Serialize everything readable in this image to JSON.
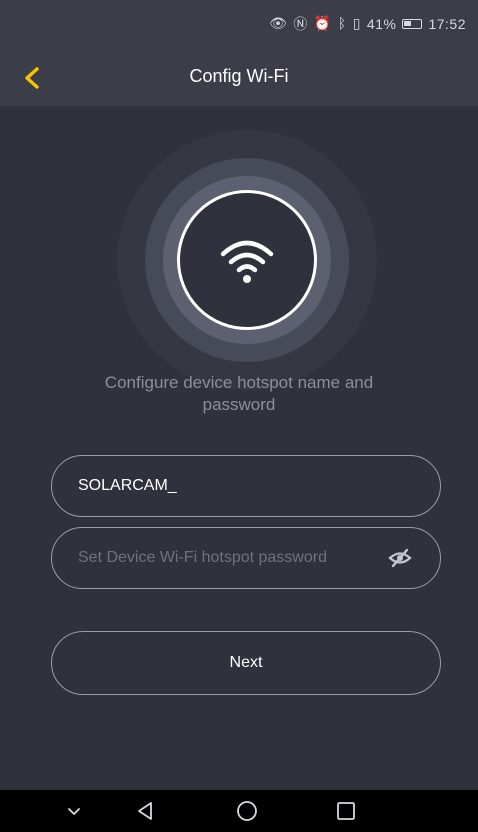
{
  "status_bar": {
    "battery_percent": "41%",
    "time": "17:52",
    "icons": [
      "eye-comfort-icon",
      "nfc-icon",
      "alarm-icon",
      "bluetooth-icon",
      "vibrate-icon",
      "battery-icon"
    ]
  },
  "header": {
    "title": "Config Wi-Fi",
    "back_icon": "chevron-left-icon",
    "accent_color": "#f5c400"
  },
  "hero": {
    "icon": "wifi-icon"
  },
  "caption": "Configure device hotspot name and password",
  "form": {
    "hotspot_name_value": "SOLARCAM_",
    "password_placeholder": "Set Device Wi-Fi hotspot password",
    "password_toggle_icon": "eye-off-icon"
  },
  "next_button": {
    "label": "Next"
  },
  "nav_bar": {
    "items": [
      "chevron-down-icon",
      "back-triangle-icon",
      "home-circle-icon",
      "recents-square-icon"
    ]
  }
}
